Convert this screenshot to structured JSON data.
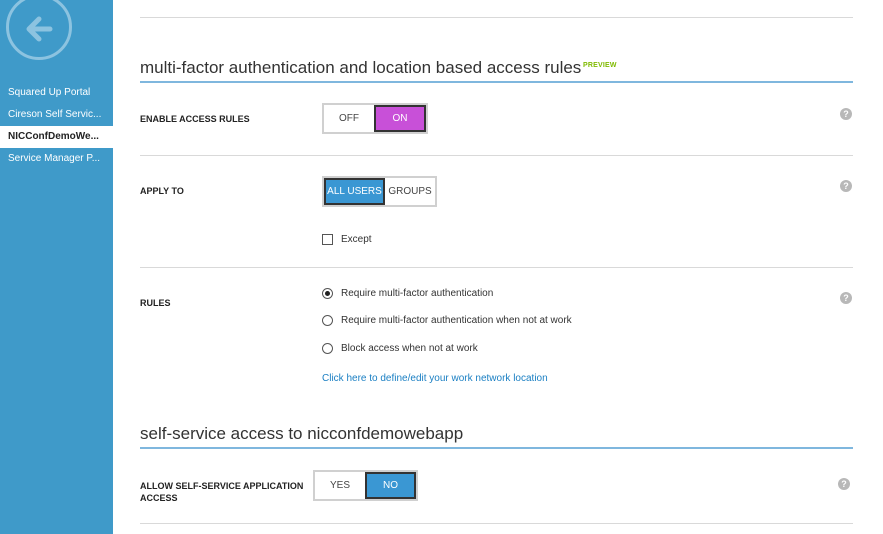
{
  "sidebar": {
    "back_icon": "back-arrow-icon",
    "items": [
      {
        "label": "Squared Up Portal"
      },
      {
        "label": "Cireson Self Servic..."
      },
      {
        "label": "NICConfDemoWe..."
      },
      {
        "label": "Service Manager P..."
      }
    ],
    "active_index": 2
  },
  "mfa_section": {
    "title": "multi-factor authentication and location based access rules",
    "badge": "PREVIEW",
    "enable_access_rules": {
      "label": "ENABLE ACCESS RULES",
      "off_label": "OFF",
      "on_label": "ON",
      "selected": "ON"
    },
    "apply_to": {
      "label": "APPLY TO",
      "all_users_label": "ALL USERS",
      "groups_label": "GROUPS",
      "selected": "ALL USERS",
      "except_label": "Except",
      "except_checked": false
    },
    "rules": {
      "label": "RULES",
      "options": [
        {
          "label": "Require multi-factor authentication",
          "checked": true
        },
        {
          "label": "Require multi-factor authentication when not at work",
          "checked": false
        },
        {
          "label": "Block access when not at work",
          "checked": false
        }
      ],
      "link": "Click here to define/edit your work network location"
    }
  },
  "self_service_section": {
    "title": "self-service access to nicconfdemowebapp",
    "allow_access": {
      "label": "ALLOW SELF-SERVICE APPLICATION ACCESS",
      "yes_label": "YES",
      "no_label": "NO",
      "selected": "NO"
    }
  },
  "help_icon": "help-question-icon",
  "colors": {
    "sidebar": "#3f9ac9",
    "on_selected": "#c850d8",
    "blue_selected": "#3a97d3",
    "badge_green": "#7fba00",
    "link_blue": "#1a7fc3"
  }
}
